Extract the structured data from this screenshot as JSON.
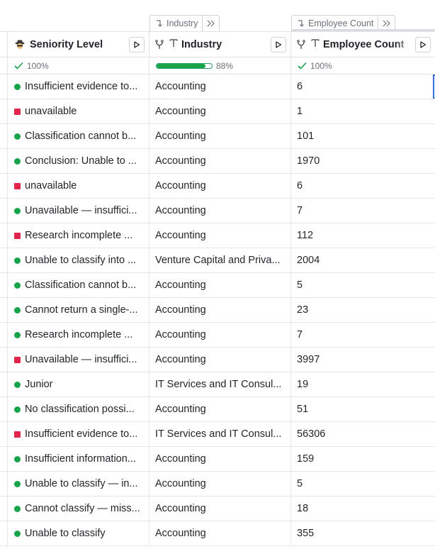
{
  "group_tabs": [
    {
      "label": "Industry"
    },
    {
      "label": "Employee Count"
    }
  ],
  "columns": [
    {
      "name": "Seniority Level",
      "icon": "spy-emoji-icon"
    },
    {
      "name": "Industry",
      "icon": "text-type-icon"
    },
    {
      "name": "Employee Count",
      "icon": "text-type-icon"
    }
  ],
  "stats": [
    {
      "label": "100%",
      "kind": "check"
    },
    {
      "label": "88%",
      "kind": "bar",
      "fill_fraction": 0.88
    },
    {
      "label": "100%",
      "kind": "check"
    }
  ],
  "colors": {
    "ok": "#16a34a",
    "error": "#e0264d",
    "progress": "#16a34a"
  },
  "rows": [
    {
      "status": "ok",
      "seniority": "Insufficient evidence to...",
      "industry": "Accounting",
      "employees": "6"
    },
    {
      "status": "error",
      "seniority": "unavailable",
      "industry": "Accounting",
      "employees": "1"
    },
    {
      "status": "ok",
      "seniority": "Classification cannot b...",
      "industry": "Accounting",
      "employees": "101"
    },
    {
      "status": "ok",
      "seniority": "Conclusion: Unable to ...",
      "industry": "Accounting",
      "employees": "1970"
    },
    {
      "status": "error",
      "seniority": "unavailable",
      "industry": "Accounting",
      "employees": "6"
    },
    {
      "status": "ok",
      "seniority": "Unavailable — insuffici...",
      "industry": "Accounting",
      "employees": "7"
    },
    {
      "status": "error",
      "seniority": "Research incomplete ...",
      "industry": "Accounting",
      "employees": "112"
    },
    {
      "status": "ok",
      "seniority": "Unable to classify into ...",
      "industry": "Venture Capital and Priva...",
      "employees": "2004"
    },
    {
      "status": "ok",
      "seniority": "Classification cannot b...",
      "industry": "Accounting",
      "employees": "5"
    },
    {
      "status": "ok",
      "seniority": "Cannot return a single-...",
      "industry": "Accounting",
      "employees": "23"
    },
    {
      "status": "ok",
      "seniority": "Research incomplete ...",
      "industry": "Accounting",
      "employees": "7"
    },
    {
      "status": "error",
      "seniority": "Unavailable — insuffici...",
      "industry": "Accounting",
      "employees": "3997"
    },
    {
      "status": "ok",
      "seniority": "Junior",
      "industry": "IT Services and IT Consul...",
      "employees": "19"
    },
    {
      "status": "ok",
      "seniority": "No classification possi...",
      "industry": "Accounting",
      "employees": "51"
    },
    {
      "status": "error",
      "seniority": "Insufficient evidence to...",
      "industry": "IT Services and IT Consul...",
      "employees": "56306"
    },
    {
      "status": "ok",
      "seniority": "Insufficient information...",
      "industry": "Accounting",
      "employees": "159"
    },
    {
      "status": "ok",
      "seniority": "Unable to classify — in...",
      "industry": "Accounting",
      "employees": "5"
    },
    {
      "status": "ok",
      "seniority": "Cannot classify — miss...",
      "industry": "Accounting",
      "employees": "18"
    },
    {
      "status": "ok",
      "seniority": "Unable to classify",
      "industry": "Accounting",
      "employees": "355"
    }
  ]
}
